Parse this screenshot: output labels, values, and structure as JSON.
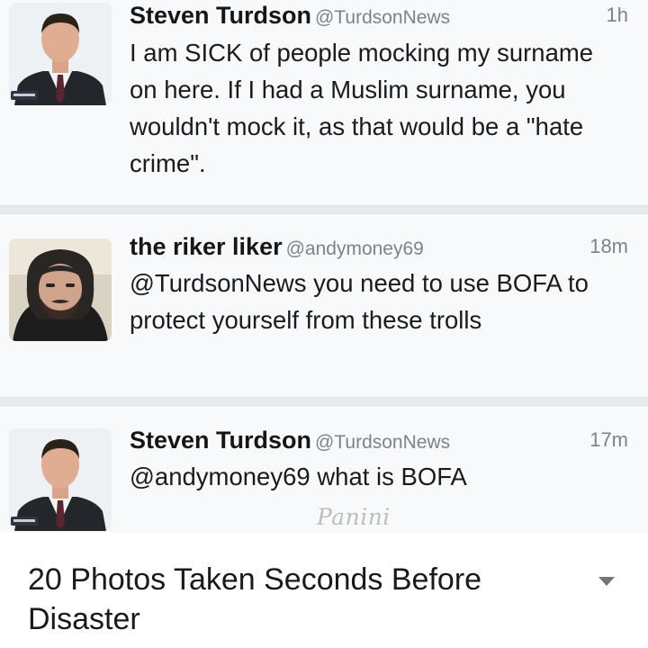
{
  "tweets": [
    {
      "name": "Steven Turdson",
      "handle": "@TurdsonNews",
      "time": "1h",
      "text": "I am SICK of people mocking my surname on here. If I had a Muslim surname, you wouldn't mock it, as that would be a \"hate crime\".",
      "avatar_icon": "profile-photo-man-suit-icon"
    },
    {
      "name": "the riker liker",
      "handle": "@andymoney69",
      "time": "18m",
      "text": "@TurdsonNews you need to use BOFA to protect yourself from these trolls",
      "avatar_icon": "profile-photo-man-beard-icon"
    },
    {
      "name": "Steven Turdson",
      "handle": "@TurdsonNews",
      "time": "17m",
      "text": "@andymoney69 what is BOFA",
      "avatar_icon": "profile-photo-man-suit-icon"
    }
  ],
  "watermark": "Panini",
  "footer": {
    "title": "20 Photos Taken Seconds Before Disaster",
    "expand_icon": "chevron-down-icon"
  },
  "colors": {
    "background": "#f7f9fb",
    "separator": "#e6eaee",
    "secondary_text": "#7d8389",
    "primary_text": "#1b1b1b"
  }
}
